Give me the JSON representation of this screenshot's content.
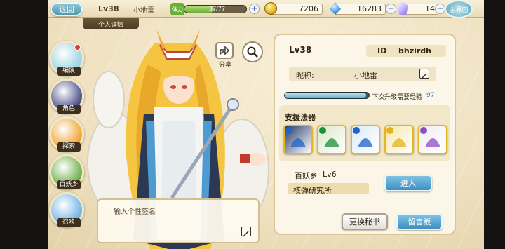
{
  "topbar": {
    "back_label": "返回",
    "level": "Lv38",
    "player_name": "小地雷",
    "stamina_label": "体力",
    "stamina_text": "37/77",
    "stamina_fraction": 0.48,
    "coins": "7206",
    "gems": "16283",
    "crystals": "14",
    "main_label": "主界面"
  },
  "sub_tab": "个人详情",
  "side_nav": [
    {
      "label": "编队",
      "badge": true,
      "color": "#9ad3e2"
    },
    {
      "label": "角色",
      "badge": false,
      "color": "#4a4f8a"
    },
    {
      "label": "探索",
      "badge": false,
      "color": "#f1a431"
    },
    {
      "label": "百妖乡",
      "badge": false,
      "color": "#6db04a"
    },
    {
      "label": "召唤",
      "badge": false,
      "color": "#6fb3e4"
    }
  ],
  "share_label": "分享",
  "signature_placeholder": "输入个性签名",
  "profile": {
    "level": "Lv38",
    "id_label": "ID",
    "id_value": "bhzirdh",
    "nickname_label": "昵称:",
    "nickname": "小地雷",
    "exp_label": "下次升级需要经验",
    "exp_value": "97",
    "exp_fraction": 0.97,
    "fq_title": "支援法器",
    "fq_items": [
      {
        "name": "red-harp-icon",
        "bg": "#2a3b6b",
        "star": "#1e63c7"
      },
      {
        "name": "green-leaf-icon",
        "bg": "#dbe9c8",
        "star": "#1e8f3a"
      },
      {
        "name": "blue-fish-icon",
        "bg": "#d9ecf6",
        "star": "#1e63c7"
      },
      {
        "name": "gold-wand-icon",
        "bg": "#f5e8a8",
        "star": "#e4b21d"
      },
      {
        "name": "red-white-charm-icon",
        "bg": "#f3ecf1",
        "star": "#8a4fc7"
      }
    ],
    "village_label": "百妖乡",
    "village_level": "Lv6",
    "institute_label": "核弹研究所",
    "enter_label": "进入",
    "change_secretary_label": "更换秘书",
    "message_board_label": "留言板"
  }
}
